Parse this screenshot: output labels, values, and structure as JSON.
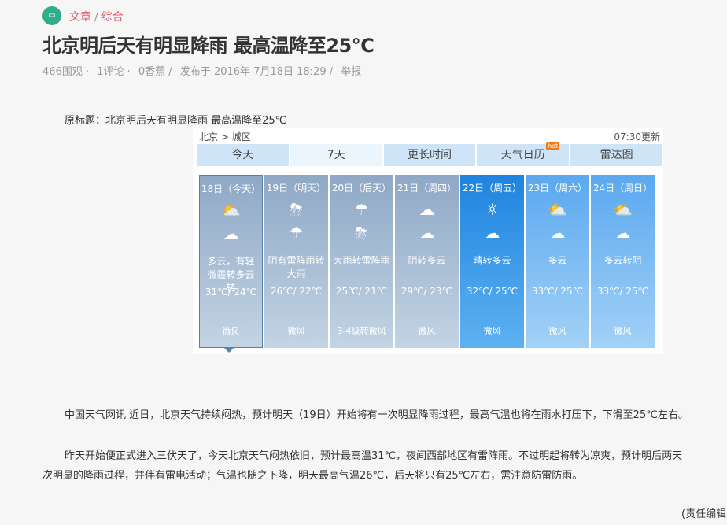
{
  "breadcrumb": {
    "icon": "chat-bubble-icon",
    "items": [
      "文章",
      "综合"
    ]
  },
  "title": "北京明后天有明显降雨 最高温降至25℃",
  "meta": {
    "views": "466围观 ·",
    "comments": "1评论 ·",
    "bananas": "0香蕉 /",
    "published": "发布于 2016年 7月18日 18:29 /",
    "report": "举报"
  },
  "original_title": "原标题：北京明后天有明显降雨 最高温降至25℃",
  "widget": {
    "location": "北京 > 城区",
    "updated": "07:30更新",
    "tabs": [
      {
        "label": "今天"
      },
      {
        "label": "7天"
      },
      {
        "label": "更长时间"
      },
      {
        "label": "天气日历",
        "badge": "hot"
      },
      {
        "label": "雷达图"
      }
    ],
    "days": [
      {
        "date": "18日（今天）",
        "icon1": "partly-cloudy-icon",
        "icon2": "cloudy-night-icon",
        "weather": "多云，有轻微霾转多云转",
        "temp": "31℃/ 24℃",
        "wind": "微风"
      },
      {
        "date": "19日（明天）",
        "icon1": "thunderstorm-icon",
        "icon2": "heavy-rain-icon",
        "weather": "阴有雷阵雨转大雨",
        "temp": "26℃/ 22℃",
        "wind": "微风"
      },
      {
        "date": "20日（后天）",
        "icon1": "heavy-rain-icon",
        "icon2": "thunderstorm-icon",
        "weather": "大雨转雷阵雨",
        "temp": "25℃/ 21℃",
        "wind": "3-4级转微风"
      },
      {
        "date": "21日（周四）",
        "icon1": "overcast-icon",
        "icon2": "cloudy-night-icon",
        "weather": "阴转多云",
        "temp": "29℃/ 23℃",
        "wind": "微风"
      },
      {
        "date": "22日（周五）",
        "icon1": "sunny-icon",
        "icon2": "cloudy-night-icon",
        "weather": "晴转多云",
        "temp": "32℃/ 25℃",
        "wind": "微风"
      },
      {
        "date": "23日（周六）",
        "icon1": "partly-cloudy-icon",
        "icon2": "cloudy-night-icon",
        "weather": "多云",
        "temp": "33℃/ 25℃",
        "wind": "微风"
      },
      {
        "date": "24日（周日）",
        "icon1": "partly-cloudy-icon",
        "icon2": "cloudy-night-icon",
        "weather": "多云转阴",
        "temp": "33℃/ 25℃",
        "wind": "微风"
      }
    ]
  },
  "body": {
    "p1": "中国天气网讯 近日，北京天气持续闷热，预计明天（19日）开始将有一次明显降雨过程，最高气温也将在雨水打压下，下滑至25℃左右。",
    "p2a": "昨天开始便正式进入三伏天了，今天北京天气闷热依旧，预计最高温31℃，夜间西部地区有雷阵雨。不过明起将转为凉爽，预计明后两天",
    "p2b": "次明显的降雨过程，并伴有雷电活动；气温也随之下降，明天最高气温26℃，后天将只有25℃左右，需注意防雷防雨。",
    "editor": "(责任编辑"
  }
}
